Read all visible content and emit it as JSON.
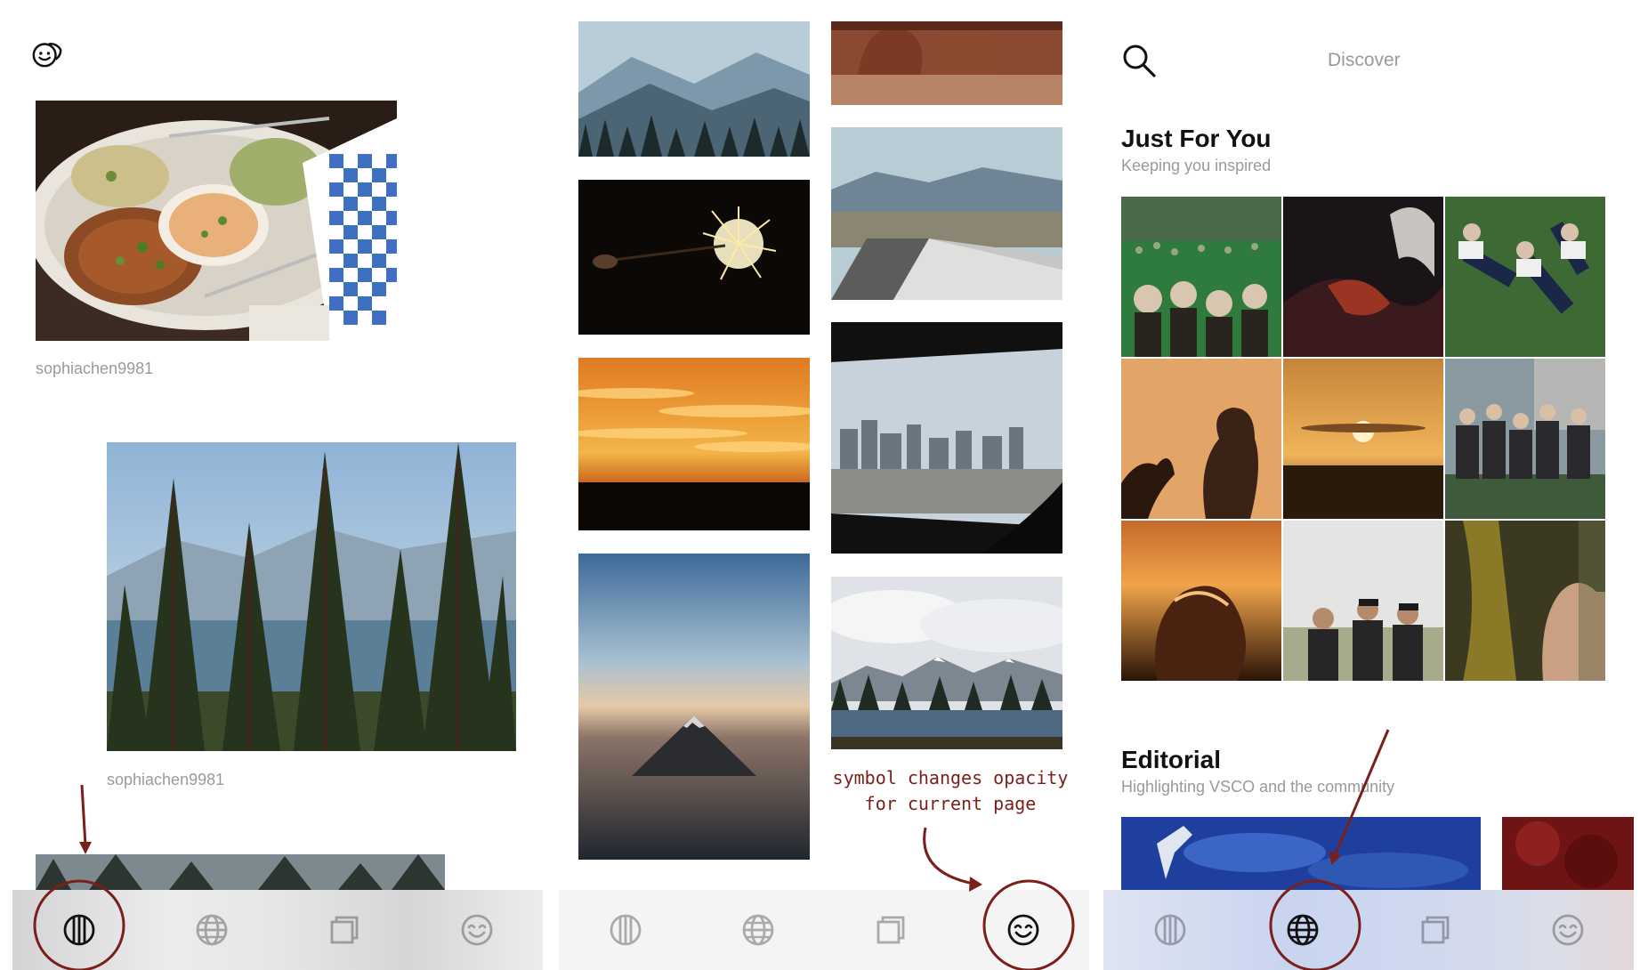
{
  "app": {
    "brand_color": "#111111",
    "annotation_color": "#7a1f1a",
    "muted_text_color": "#9a9a9a"
  },
  "feed_panel": {
    "header_icon": "friends-face-icon",
    "posts": [
      {
        "username": "sophiachen9981",
        "photo": "mezze-platter"
      },
      {
        "username": "sophiachen9981",
        "photo": "pine-forest-lake"
      },
      {
        "photo": "forest-partial"
      }
    ]
  },
  "journal_panel": {
    "photos_left": [
      "mountain-valley",
      "sparkler-night",
      "orange-sunset-clouds",
      "mountain-aerial-dusk"
    ],
    "photos_right": [
      "red-rock-arch",
      "highway-mountains",
      "car-window-city",
      "alpine-lake-clouds"
    ],
    "annotation": {
      "line1": "symbol changes opacity",
      "line2": "for current page"
    }
  },
  "discover_panel": {
    "search_icon": "search-icon",
    "title": "Discover",
    "sections": [
      {
        "title": "Just For You",
        "subtitle": "Keeping you inspired",
        "grid": [
          "festival-crowd",
          "red-fabric",
          "friends-on-grass",
          "silhouette-profile",
          "sunset-horizon",
          "family-group",
          "hair-backlit",
          "three-men-field",
          "yellow-curtain-face"
        ]
      },
      {
        "title": "Editorial",
        "subtitle": "Highlighting VSCO and the community"
      }
    ]
  },
  "nav": {
    "items": [
      {
        "name": "feed",
        "icon": "feed-circle-icon"
      },
      {
        "name": "discover",
        "icon": "globe-icon"
      },
      {
        "name": "studio",
        "icon": "studio-squares-icon"
      },
      {
        "name": "profile",
        "icon": "smiley-face-icon"
      }
    ],
    "active_per_panel": [
      "feed",
      "profile",
      "discover"
    ]
  }
}
